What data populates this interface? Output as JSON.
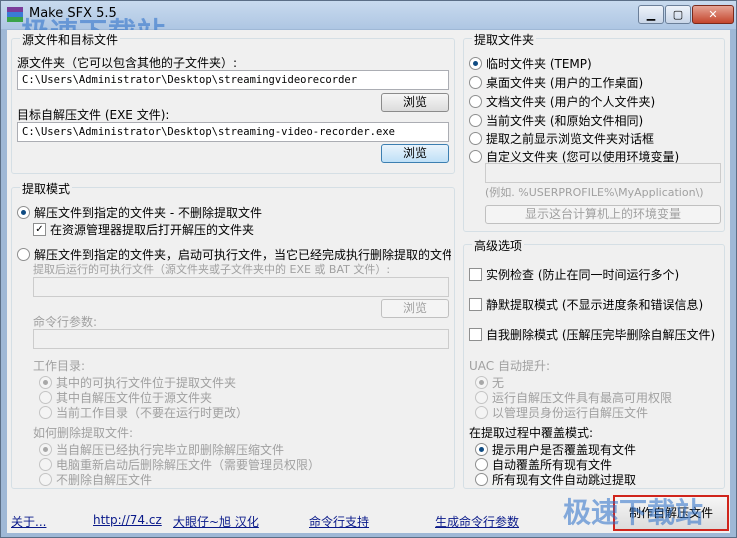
{
  "window": {
    "title": "Make SFX 5.5",
    "watermark": "极速下载站"
  },
  "source_section": {
    "legend": "源文件和目标文件",
    "source_label": "源文件夹（它可以包含其他的子文件夹）:",
    "source_value": "C:\\Users\\Administrator\\Desktop\\streamingvideorecorder",
    "source_browse": "浏览",
    "target_label": "目标自解压文件 (EXE 文件):",
    "target_value": "C:\\Users\\Administrator\\Desktop\\streaming-video-recorder.exe",
    "target_browse": "浏览"
  },
  "extract_mode": {
    "legend": "提取模式",
    "opt1": "解压文件到指定的文件夹 - 不删除提取文件",
    "opt1_check": "在资源管理器提取后打开解压的文件夹",
    "opt1_check_mark": "✓",
    "opt2": "解压文件到指定的文件夹，启动可执行文件，当它已经完成执行删除提取的文件",
    "exe_label": "提取后运行的可执行文件（源文件夹或子文件夹中的 EXE 或 BAT 文件）:",
    "exe_browse": "浏览",
    "cmd_label": "命令行参数:",
    "workdir_label": "工作目录:",
    "workdir_opts": [
      "其中的可执行文件位于提取文件夹",
      "其中自解压文件位于源文件夹",
      "当前工作目录（不要在运行时更改）"
    ],
    "delete_label": "如何删除提取文件:",
    "delete_opts": [
      "当自解压已经执行完毕立即删除解压缩文件",
      "电脑重新启动后删除解压文件（需要管理员权限）",
      "不删除自解压文件"
    ]
  },
  "extract_folder": {
    "legend": "提取文件夹",
    "options": [
      "临时文件夹 (TEMP)",
      "桌面文件夹 (用户的工作桌面)",
      "文档文件夹 (用户的个人文件夹)",
      "当前文件夹 (和原始文件相同)",
      "提取之前显示浏览文件夹对话框",
      "自定义文件夹 (您可以使用环境变量)"
    ],
    "example": "(例如. %USERPROFILE%\\MyApplication\\)",
    "env_button": "显示这台计算机上的环境变量"
  },
  "advanced": {
    "legend": "高级选项",
    "checks": [
      "实例检查 (防止在同一时间运行多个)",
      "静默提取模式 (不显示进度条和错误信息)",
      "自我删除模式 (压解压完毕删除自解压文件)"
    ],
    "uac_label": "UAC 自动提升:",
    "uac_opts": [
      "无",
      "运行自解压文件具有最高可用权限",
      "以管理员身份运行自解压文件"
    ],
    "overwrite_label": "在提取过程中覆盖模式:",
    "overwrite_opts": [
      "提示用户是否覆盖现有文件",
      "自动覆盖所有现有文件",
      "所有现有文件自动跳过提取"
    ]
  },
  "footer": {
    "about": "关于...",
    "url": "http://74.cz",
    "credit": "大眼仔~旭 汉化",
    "cmdline": "命令行支持",
    "gen_cmdline": "生成命令行参数",
    "make": "制作自解压文件"
  }
}
